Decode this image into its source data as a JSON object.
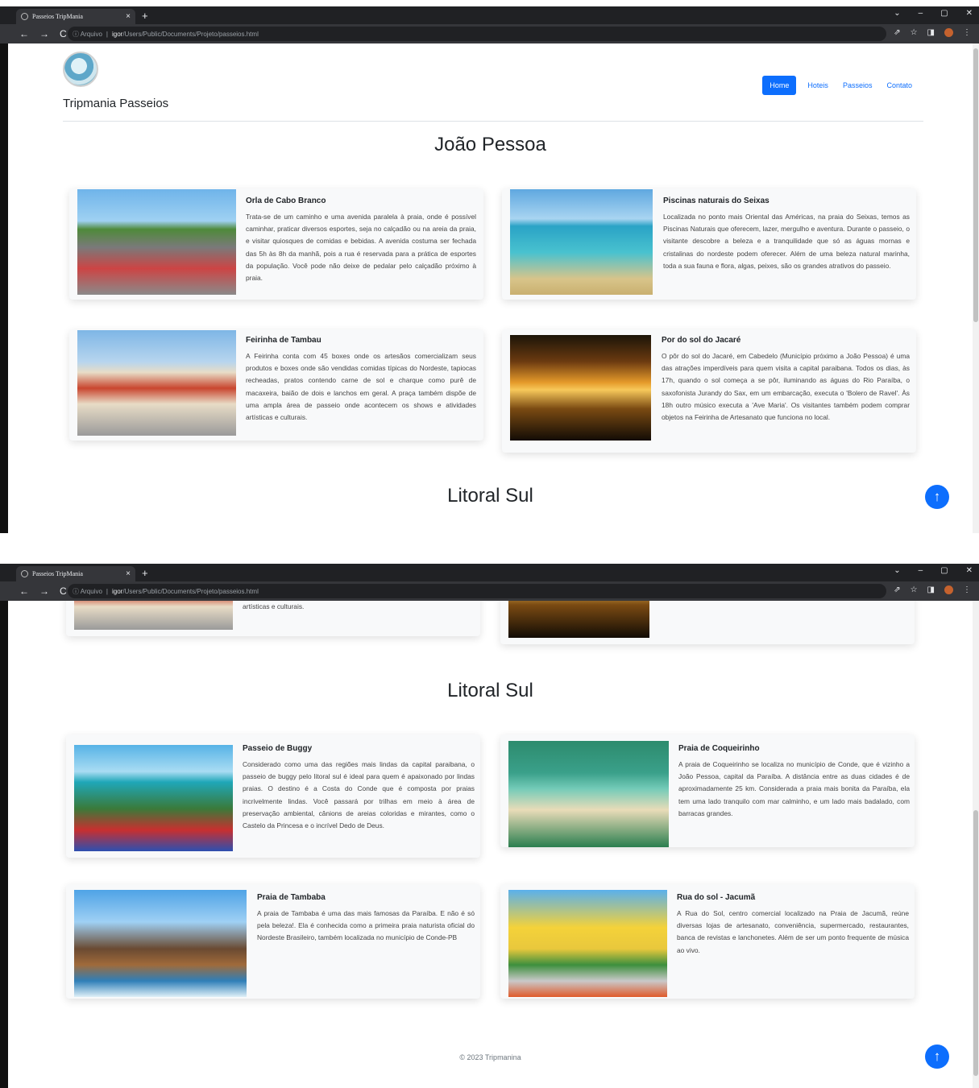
{
  "browser": {
    "tab_title": "Passeios TripMania",
    "tab_close": "×",
    "new_tab": "+",
    "window_controls": [
      "⌄",
      "–",
      "▢",
      "✕"
    ],
    "nav_back": "←",
    "nav_forward": "→",
    "nav_reload": "C",
    "url_prefix": "ⓘ Arquivo",
    "url_host": "igor",
    "url_path": "/Users/Public/Documents/Projeto/passeios.html"
  },
  "site": {
    "brand": "Tripmania Passeios",
    "nav": [
      "Home",
      "Hoteis",
      "Passeios",
      "Contato"
    ],
    "footer": "© 2023 Tripmanina"
  },
  "sections": [
    {
      "title": "João Pessoa",
      "cards": [
        {
          "title": "Orla de Cabo Branco",
          "text": "Trata-se de um caminho e uma avenida paralela à praia, onde é possível caminhar, praticar diversos esportes, seja no calçadão ou na areia da praia, e visitar quiosques de comidas e bebidas. A avenida costuma ser fechada das 5h às 8h da manhã, pois a rua é reservada para a prática de esportes da população. Você pode não deixe de pedalar pelo calçadão próximo à praia."
        },
        {
          "title": "Piscinas naturais do Seixas",
          "text": "Localizada no ponto mais Oriental das Américas, na praia do Seixas, temos as Piscinas Naturais que oferecem, lazer, mergulho e aventura. Durante o passeio, o visitante descobre a beleza e a tranquilidade que só as águas mornas e cristalinas do nordeste podem oferecer. Além de uma beleza natural marinha, toda a sua fauna e flora, algas, peixes, são os grandes atrativos do passeio."
        },
        {
          "title": "Feirinha de Tambau",
          "text": "A Feirinha conta com 45 boxes onde os artesãos comercializam seus produtos e boxes onde são vendidas comidas típicas do Nordeste, tapiocas recheadas, pratos contendo carne de sol e charque como purê de macaxeira, baião de dois e lanchos em geral. A praça também dispõe de uma ampla área de passeio onde acontecem os shows e atividades artísticas e culturais."
        },
        {
          "title": "Por do sol do Jacaré",
          "text": "O pôr do sol do Jacaré, em Cabedelo (Município próximo a João Pessoa) é uma das atrações imperdíveis para quem visita a capital paraibana. Todos os dias, às 17h, quando o sol começa a se pôr, iluminando as águas do Rio Paraíba, o saxofonista Jurandy do Sax, em um embarcação, executa o 'Bolero de Ravel'. Às 18h outro músico executa a 'Ave Maria'. Os visitantes também podem comprar objetos na Feirinha de Artesanato que funciona no local."
        }
      ]
    },
    {
      "title": "Litoral Sul",
      "cards": [
        {
          "title": "Passeio de Buggy",
          "text": "Considerado como uma das regiões mais lindas da capital paraibana, o passeio de buggy pelo litoral sul é ideal para quem é apaixonado por lindas praias. O destino é a Costa do Conde que é composta por praias incrivelmente lindas. Você passará por trilhas em meio à área de preservação ambiental, cânions de areias coloridas e mirantes, como o Castelo da Princesa e o incrível Dedo de Deus."
        },
        {
          "title": "Praia de Coqueirinho",
          "text": "A praia de Coqueirinho se localiza no município de Conde, que é vizinho a João Pessoa, capital da Paraíba. A distância entre as duas cidades é de aproximadamente 25 km. Considerada a praia mais bonita da Paraíba, ela tem uma lado tranquilo com mar calminho, e um lado mais badalado, com barracas grandes."
        },
        {
          "title": "Praia de Tambaba",
          "text": "A praia de Tambaba é uma das mais famosas da Paraíba. E não é só pela beleza!. Ela é conhecida como a primeira praia naturista oficial do Nordeste Brasileiro, também localizada no município de Conde-PB"
        },
        {
          "title": "Rua do sol - Jacumã",
          "text": "A Rua do Sol, centro comercial localizado na Praia de Jacumã, reúne diversas lojas de artesanato, conveniência, supermercado, restaurantes, banca de revistas e lanchonetes. Além de ser um ponto frequente de música ao vivo."
        }
      ]
    }
  ],
  "ui": {
    "back_to_top": "↑",
    "icons": {
      "favicon": "globe-icon",
      "back_to_top": "arrow-up-icon",
      "share": "share-icon",
      "bookmark": "star-icon",
      "sidepanel": "sidepanel-icon",
      "profile": "profile-avatar",
      "menu": "kebab-menu-icon"
    },
    "tb_icons": [
      "⇗",
      "☆",
      "◨",
      "⋮"
    ],
    "accent": "#0d6efd"
  }
}
